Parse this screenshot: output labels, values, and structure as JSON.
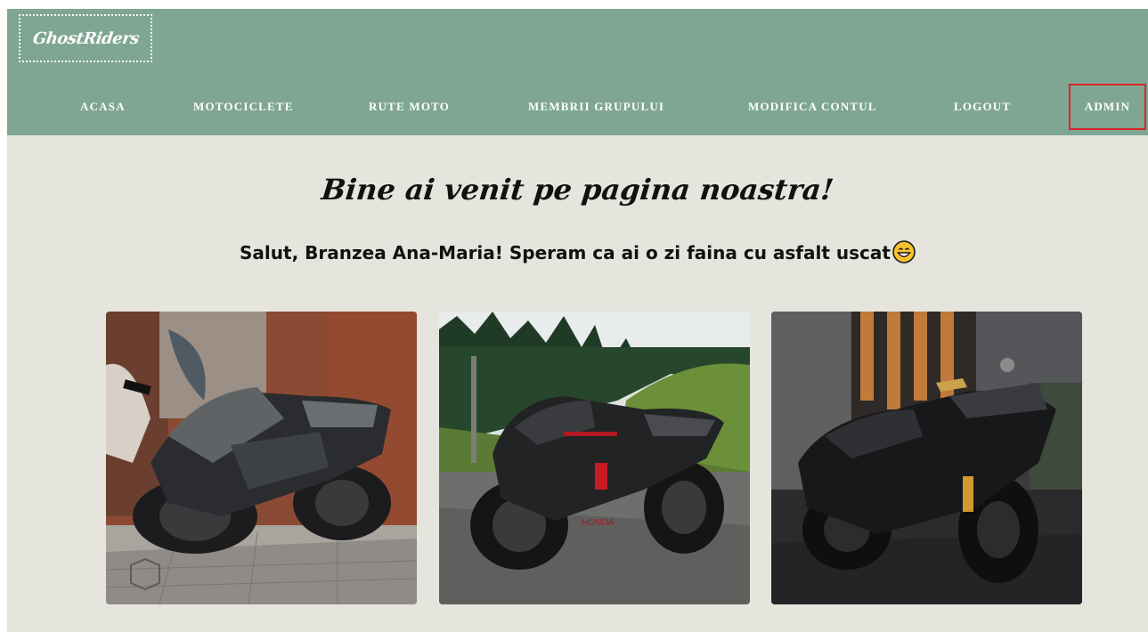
{
  "header": {
    "logo": "GhostRiders",
    "nav": [
      {
        "label": "ACASA"
      },
      {
        "label": "MOTOCICLETE"
      },
      {
        "label": "RUTE MOTO"
      },
      {
        "label": "MEMBRII GRUPULUI"
      },
      {
        "label": "MODIFICA CONTUL"
      },
      {
        "label": "LOGOUT"
      },
      {
        "label": "ADMIN"
      }
    ]
  },
  "main": {
    "title": "Bine ai venit pe pagina noastra!",
    "greeting": "Salut, Branzea Ana-Maria! Speram ca ai o zi faina cu asfalt uscat",
    "greeting_emoji": "grinning-face-emoji"
  },
  "gallery": [
    {
      "name": "kawasaki-ninja-photo"
    },
    {
      "name": "honda-cbr-photo"
    },
    {
      "name": "yamaha-r1-photo"
    }
  ],
  "colors": {
    "navbar": "#7fa693",
    "background": "#e5e5de",
    "admin_highlight": "#d8262b",
    "nav_text": "#ffffff"
  }
}
